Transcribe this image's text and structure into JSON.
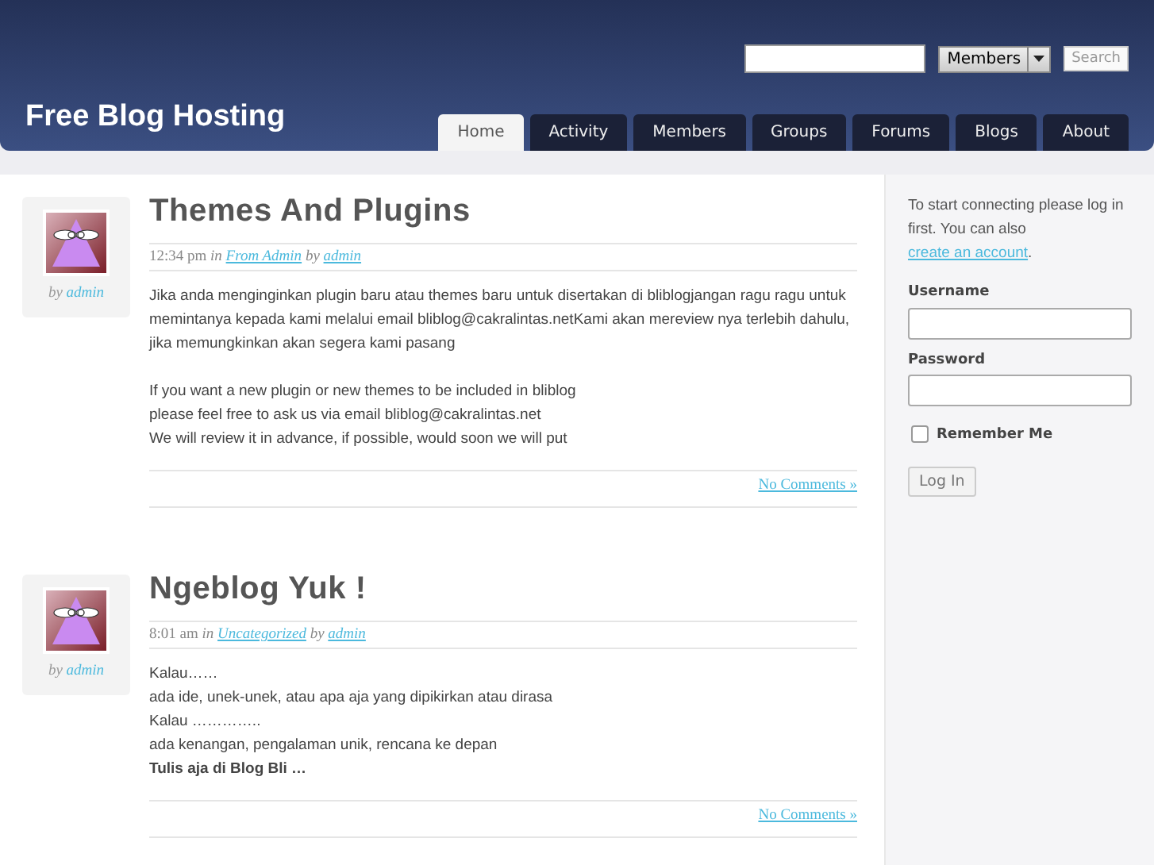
{
  "header": {
    "site_title": "Free Blog Hosting",
    "search": {
      "scope": "Members",
      "button": "Search"
    },
    "tabs": [
      {
        "label": "Home",
        "selected": true
      },
      {
        "label": "Activity",
        "selected": false
      },
      {
        "label": "Members",
        "selected": false
      },
      {
        "label": "Groups",
        "selected": false
      },
      {
        "label": "Forums",
        "selected": false
      },
      {
        "label": "Blogs",
        "selected": false
      },
      {
        "label": "About",
        "selected": false
      }
    ]
  },
  "posts": [
    {
      "author_by": "by",
      "author": "admin",
      "title": "Themes And Plugins",
      "time": "12:34 pm",
      "in": "in",
      "category": "From Admin",
      "by": "by",
      "meta_author": "admin",
      "paragraphs": [
        [
          {
            "text": "Jika anda menginginkan plugin baru atau themes baru untuk disertakan di bliblogjangan ragu ragu untuk memintanya kepada kami melalui email bliblog@cakralintas.netKami akan mereview nya terlebih dahulu, jika memungkinkan akan segera kami pasang",
            "bold": false
          }
        ],
        [
          {
            "text": "If you want a new plugin or new themes to be included in bliblog",
            "bold": false
          },
          {
            "text": "please feel free to ask us via email bliblog@cakralintas.net",
            "bold": false
          },
          {
            "text": "We will review it in advance, if possible, would soon we will put",
            "bold": false
          }
        ]
      ],
      "comments": "No Comments »"
    },
    {
      "author_by": "by",
      "author": "admin",
      "title": "Ngeblog Yuk !",
      "time": "8:01 am",
      "in": "in",
      "category": "Uncategorized",
      "by": "by",
      "meta_author": "admin",
      "paragraphs": [
        [
          {
            "text": "Kalau……",
            "bold": false
          },
          {
            "text": "ada ide, unek-unek, atau apa aja yang dipikirkan atau  dirasa",
            "bold": false
          },
          {
            "text": "Kalau …………..",
            "bold": false
          },
          {
            "text": "ada kenangan, pengalaman unik, rencana  ke depan",
            "bold": false
          },
          {
            "text": "Tulis aja di Blog Bli …",
            "bold": true
          }
        ]
      ],
      "comments": "No Comments »"
    }
  ],
  "sidebar": {
    "intro": "To start connecting please log in first. You can also",
    "intro_link": "create an account",
    "intro_end": ".",
    "username_label": "Username",
    "password_label": "Password",
    "remember": {
      "label": "Remember Me",
      "checked": false
    },
    "login_button": "Log In"
  }
}
